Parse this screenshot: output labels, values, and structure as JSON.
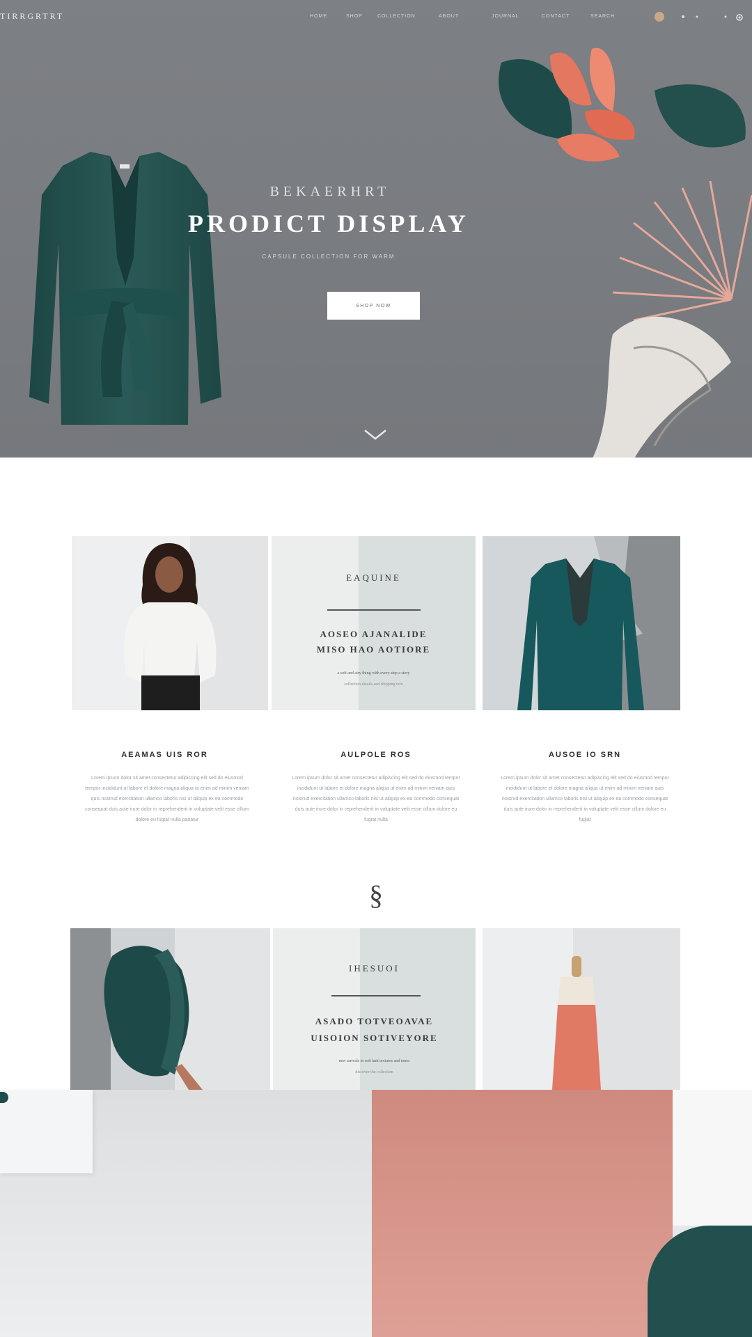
{
  "header": {
    "logo": "TIRRGRTRT",
    "nav": [
      "HOME",
      "SHOP",
      "COLLECTION",
      "ABOUT",
      "JOURNAL",
      "CONTACT",
      "SEARCH"
    ]
  },
  "hero": {
    "eyebrow": "BEKAERHRT",
    "title": "PRODICT DISPLAY",
    "subtitle": "CAPSULE COLLECTION FOR WARM",
    "button": "SHOP NOW"
  },
  "feature1": {
    "eyebrow": "EAQUINE",
    "heading_line1": "AOSEO AJANALIDE",
    "heading_line2": "MISO HAO AOTIORE",
    "small_line1": "a soft and airy thing with every step a story",
    "small_line2": "collection details and shipping info"
  },
  "columns": [
    {
      "title": "AEAMAS UIS ROR",
      "text": "Lorem ipsum dolor sit amet consectetur adipiscing elit sed do eiusmod tempor incididunt ut labore et dolore magna aliqua ut enim ad minim veniam quis nostrud exercitation ullamco laboris nisi ut aliquip ex ea commodo consequat duis aute irure dolor in reprehenderit in voluptate velit esse cillum dolore eu fugiat nulla pariatur"
    },
    {
      "title": "AULPOLE ROS",
      "text": "Lorem ipsum dolor sit amet consectetur adipiscing elit sed do eiusmod tempor incididunt ut labore et dolore magna aliqua ut enim ad minim veniam quis nostrud exercitation ullamco laboris nisi ut aliquip ex ea commodo consequat duis aute irure dolor in reprehenderit in voluptate velit esse cillum dolore eu fugiat nulla"
    },
    {
      "title": "AUSOE IO SRN",
      "text": "Lorem ipsum dolor sit amet consectetur adipiscing elit sed do eiusmod tempor incididunt ut labore et dolore magna aliqua ut enim ad minim veniam quis nostrud exercitation ullamco laboris nisi ut aliquip ex ea commodo consequat duis aute irure dolor in reprehenderit in voluptate velit esse cillum dolore eu fugiat"
    }
  ],
  "divider_symbol": "§",
  "feature2": {
    "eyebrow": "IHESUOI",
    "heading_line1": "ASADO TOTVEOAVAE",
    "heading_line2": "UISOION SOTIVEYORE",
    "small_line1": "new arrivals in soft knit textures and tones",
    "small_line2": "discover the collection"
  },
  "colors": {
    "hero_bg": "#7a7d81",
    "teal": "#1f4d4c",
    "coral": "#e4775f",
    "blush": "#d9978c",
    "light_gray": "#dfe3e3"
  }
}
